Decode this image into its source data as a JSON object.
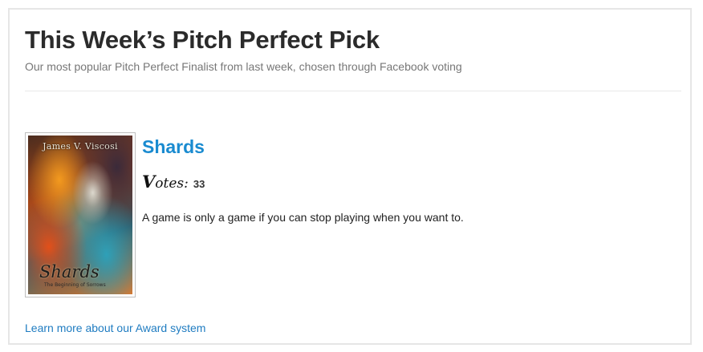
{
  "header": {
    "title": "This Week’s Pitch Perfect Pick",
    "subtitle": "Our most popular Pitch Perfect Finalist from last week, chosen through Facebook voting"
  },
  "book": {
    "cover_author": "James V. Viscosi",
    "cover_title": "Shards",
    "cover_subtitle": "The Beginning of Sorrows",
    "title": "Shards",
    "votes_label_initial": "V",
    "votes_label_rest": "otes:",
    "votes_count": "33",
    "tagline": "A game is only a game if you can stop playing when you want to."
  },
  "footer": {
    "learn_more_link": "Learn more about our Award system"
  },
  "colors": {
    "link": "#1a8bd0",
    "title_text": "#2b2b2b",
    "subtitle_text": "#777777",
    "panel_border": "#e6e6e6"
  }
}
